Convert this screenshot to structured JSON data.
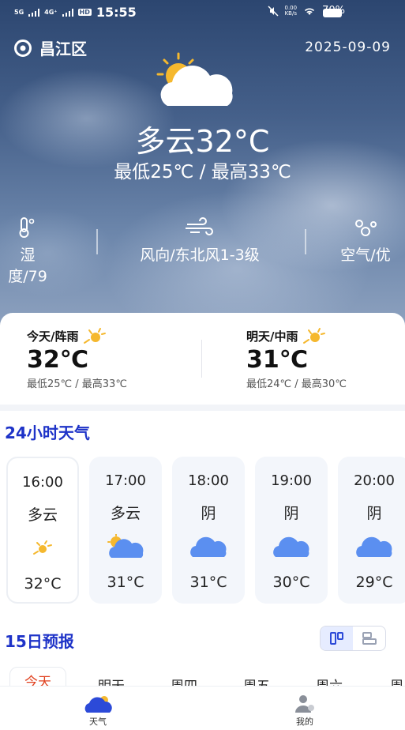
{
  "status_bar": {
    "signal_1": "5G",
    "signal_2": "4G⁺",
    "time": "15:55",
    "data_speed": "0.00",
    "data_unit": "KB/s",
    "battery": "70%"
  },
  "header": {
    "location": "昌江区",
    "date": "2025-09-09"
  },
  "current": {
    "condition": "多云32°C",
    "range": "最低25℃  /  最高33℃",
    "icon": "partly-cloudy-icon"
  },
  "metrics": [
    {
      "label": "湿度/79",
      "icon": "thermometer-icon"
    },
    {
      "label": "风向/东北风1-3级",
      "icon": "wind-icon"
    },
    {
      "label": "空气/优",
      "icon": "air-icon"
    }
  ],
  "today_cards": [
    {
      "title": "今天/阵雨",
      "temp": "32℃",
      "range": "最低25℃ / 最高33℃"
    },
    {
      "title": "明天/中雨",
      "temp": "31℃",
      "range": "最低24℃ / 最高30℃"
    }
  ],
  "hourly": {
    "title": "24小时天气",
    "items": [
      {
        "time": "16:00",
        "cond": "多云",
        "temp": "32°C",
        "icon": "sun-small-icon"
      },
      {
        "time": "17:00",
        "cond": "多云",
        "temp": "31°C",
        "icon": "partly-cloudy-icon"
      },
      {
        "time": "18:00",
        "cond": "阴",
        "temp": "31°C",
        "icon": "cloud-icon"
      },
      {
        "time": "19:00",
        "cond": "阴",
        "temp": "30°C",
        "icon": "cloud-icon"
      },
      {
        "time": "20:00",
        "cond": "阴",
        "temp": "29°C",
        "icon": "cloud-icon"
      }
    ]
  },
  "forecast": {
    "title": "15日预报",
    "tabs": [
      "今天",
      "明天",
      "周四",
      "周五",
      "周六",
      "周"
    ]
  },
  "nav": {
    "weather": "天气",
    "mine": "我的"
  },
  "colors": {
    "accent_blue": "#1e33c8",
    "active_red": "#e0401e",
    "cloud_blue": "#5b8ff0",
    "sun_yellow": "#f5b82e"
  }
}
